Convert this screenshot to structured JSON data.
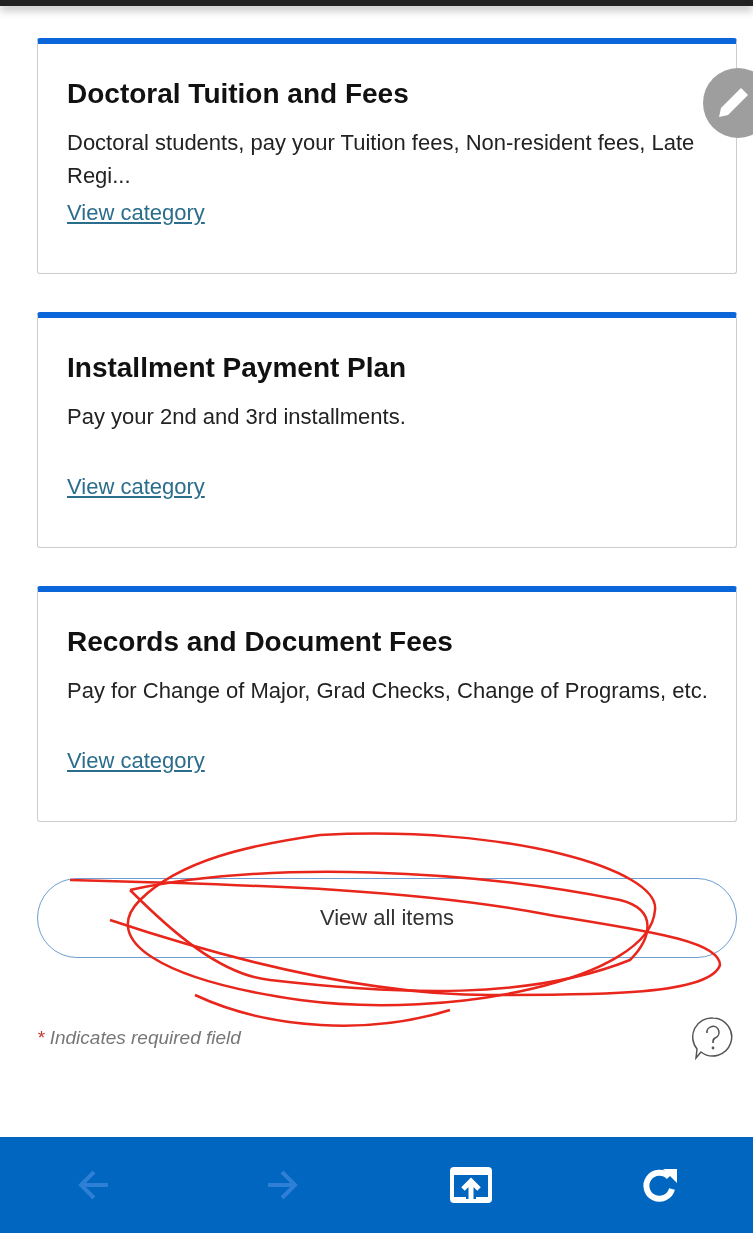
{
  "cards": [
    {
      "title": "Doctoral Tuition and Fees",
      "description": "Doctoral students, pay your Tuition fees, Non-resident fees, Late Regi...",
      "link": "View category"
    },
    {
      "title": "Installment Payment Plan",
      "description": "Pay your 2nd and 3rd installments.",
      "link": "View category"
    },
    {
      "title": "Records and Document Fees",
      "description": "Pay for Change of Major, Grad Checks, Change of Programs, etc.",
      "link": "View category"
    }
  ],
  "view_all_button": "View all items",
  "required_note": {
    "mark": "*",
    "text": "Indicates required field"
  },
  "toolbar": [
    {
      "kind": "back",
      "disabled": true
    },
    {
      "kind": "forward",
      "disabled": true
    },
    {
      "kind": "open-external",
      "disabled": false
    },
    {
      "kind": "reload",
      "disabled": false
    }
  ]
}
